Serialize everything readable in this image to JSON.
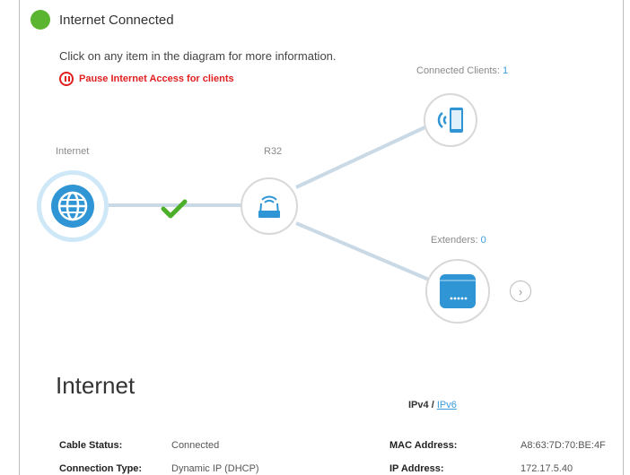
{
  "status": {
    "text": "Internet Connected",
    "color": "#5cb531"
  },
  "hint": "Click on any item in the diagram for more information.",
  "pause_link": "Pause Internet Access for clients",
  "diagram": {
    "internet_label": "Internet",
    "router_label": "R32",
    "clients_label": "Connected Clients:",
    "clients_count": "1",
    "extenders_label": "Extenders:",
    "extenders_count": "0",
    "accent_color": "#3a9bd9"
  },
  "section": {
    "title": "Internet",
    "ip_tab_active": "IPv4",
    "ip_tab_sep": "/",
    "ip_tab_other": "IPv6",
    "rows": [
      {
        "label": "Cable Status:",
        "value": "Connected"
      },
      {
        "label": "Connection Type:",
        "value": "Dynamic IP (DHCP)"
      }
    ],
    "right_rows": [
      {
        "label": "MAC Address:",
        "value": "A8:63:7D:70:BE:4F"
      },
      {
        "label": "IP Address:",
        "value": "172.17.5.40"
      }
    ]
  }
}
